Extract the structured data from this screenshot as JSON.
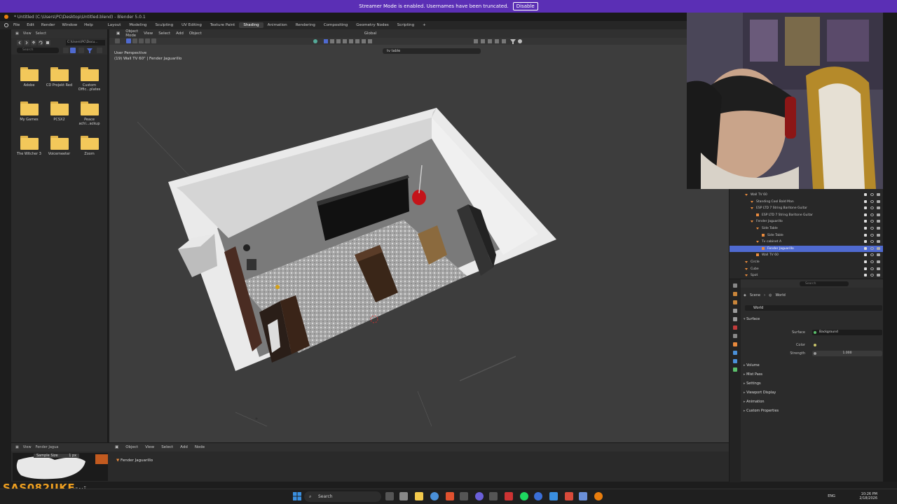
{
  "banner": {
    "message": "Streamer Mode is enabled. Usernames have been truncated.",
    "button": "Disable"
  },
  "window": {
    "title": "* Untitled (C:\\Users\\PC\\Desktop\\Untitled.blend) - Blender 5.0.1"
  },
  "menu": {
    "file": "File",
    "edit": "Edit",
    "render": "Render",
    "window": "Window",
    "help": "Help"
  },
  "workspaces": [
    "Layout",
    "Modeling",
    "Sculpting",
    "UV Editing",
    "Texture Paint",
    "Shading",
    "Animation",
    "Rendering",
    "Compositing",
    "Geometry Nodes",
    "Scripting"
  ],
  "active_workspace": "Shading",
  "filebrowser": {
    "header": [
      "View",
      "Select"
    ],
    "path": "C:\\Users\\PC\\Docu...",
    "search_placeholder": "Search",
    "folders": [
      {
        "label": "Adobe"
      },
      {
        "label": "CD Projekt Red"
      },
      {
        "label": "Custom Offic...plates"
      },
      {
        "label": "My Games"
      },
      {
        "label": "PCSX2"
      },
      {
        "label": "Peace achi...ackup"
      },
      {
        "label": "The Witcher 3"
      },
      {
        "label": "Voicemeeter"
      },
      {
        "label": "Zoom"
      }
    ]
  },
  "viewport": {
    "header": {
      "mode": "Object Mode",
      "view": "View",
      "select": "Select",
      "add": "Add",
      "object": "Object",
      "orientation": "Global"
    },
    "search_value": "tv table",
    "info_line1": "User Perspective",
    "info_line2": "(19) Wall TV 60\" | Fender Jaguarillo"
  },
  "timeline": {
    "header": [
      "Object",
      "View",
      "Select",
      "Add",
      "Node"
    ],
    "item": "Fender Jaguarillo"
  },
  "imgpanel": {
    "header": [
      "View",
      "Fender Jagua"
    ],
    "sample_label": "Sample Size",
    "sample_value": "1 px"
  },
  "outliner": {
    "rows": [
      {
        "name": "Wall TV 60",
        "indent": 1,
        "type": "tri"
      },
      {
        "name": "Standing Cool Bald Man",
        "indent": 2,
        "type": "tri"
      },
      {
        "name": "ESP LTD 7 String Baritone Guitar",
        "indent": 2,
        "type": "tri"
      },
      {
        "name": "ESP LTD 7 String Baritone Guitar",
        "indent": 3,
        "type": "mesh"
      },
      {
        "name": "Fender Jaguarillo",
        "indent": 2,
        "type": "tri"
      },
      {
        "name": "Side Table",
        "indent": 3,
        "type": "tri"
      },
      {
        "name": "Side Table",
        "indent": 4,
        "type": "mesh"
      },
      {
        "name": "Tv cabinet A",
        "indent": 3,
        "type": "tri"
      },
      {
        "name": "Fender Jaguarillo",
        "indent": 4,
        "type": "mesh",
        "selected": true
      },
      {
        "name": "Wall TV 60",
        "indent": 3,
        "type": "mesh"
      },
      {
        "name": "Circle",
        "indent": 1,
        "type": "tri"
      },
      {
        "name": "Cube",
        "indent": 1,
        "type": "tri"
      },
      {
        "name": "Spot",
        "indent": 1,
        "type": "tri"
      }
    ]
  },
  "properties": {
    "search_placeholder": "Search",
    "crumb_scene": "Scene",
    "crumb_world": "World",
    "world_name": "World",
    "surface_section": "Surface",
    "surface_label": "Surface",
    "surface_value": "Background",
    "color_label": "Color",
    "strength_label": "Strength",
    "strength_value": "1.000",
    "sections": [
      "Volume",
      "Mist Pass",
      "Settings",
      "Viewport Display",
      "Animation",
      "Custom Properties"
    ]
  },
  "watermark": {
    "name": "SAS082UKE",
    "extra": "تيت"
  },
  "taskbar": {
    "search": "Search",
    "lang": "ENG",
    "time": "10:26 PM",
    "date": "2/18/2026"
  },
  "colors": {
    "banner": "#5b2fb5",
    "selection": "#4f6ad0",
    "folder": "#f3c85a",
    "blender_orange": "#e87d0d"
  }
}
